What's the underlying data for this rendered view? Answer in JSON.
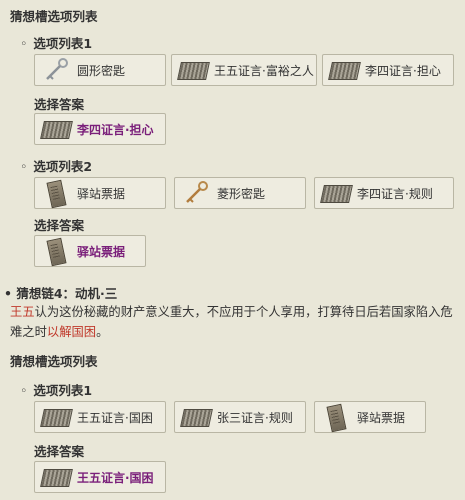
{
  "section1": {
    "title": "猜想槽选项列表",
    "list1": {
      "heading": "选项列表1",
      "options": [
        {
          "label": "圆形密匙",
          "icon": "key-icon"
        },
        {
          "label": "王五证言·富裕之人",
          "icon": "document-icon"
        },
        {
          "label": "李四证言·担心",
          "icon": "document-icon"
        }
      ],
      "answer_heading": "选择答案",
      "answer": {
        "label": "李四证言·担心",
        "icon": "document-icon"
      }
    },
    "list2": {
      "heading": "选项列表2",
      "options": [
        {
          "label": "驿站票据",
          "icon": "slip-icon"
        },
        {
          "label": "菱形密匙",
          "icon": "key-icon"
        },
        {
          "label": "李四证言·规则",
          "icon": "document-icon"
        }
      ],
      "answer_heading": "选择答案",
      "answer": {
        "label": "驿站票据",
        "icon": "slip-icon"
      }
    }
  },
  "chain4": {
    "title": "猜想链4：动机·三",
    "text_name": "王五",
    "text_body": "认为这份秘藏的财产意义重大，不应用于个人享用，打算待日后若国家陷入危难之时",
    "text_highlight": "以解国困",
    "text_end": "。"
  },
  "section2": {
    "title": "猜想槽选项列表",
    "list1": {
      "heading": "选项列表1",
      "options": [
        {
          "label": "王五证言·国困",
          "icon": "document-icon"
        },
        {
          "label": "张三证言·规则",
          "icon": "document-icon"
        },
        {
          "label": "驿站票据",
          "icon": "slip-icon"
        }
      ],
      "answer_heading": "选择答案",
      "answer": {
        "label": "王五证言·国困",
        "icon": "document-icon"
      }
    }
  },
  "colors": {
    "answer_text": "#7a1f7a",
    "highlight_red": "#c0392b",
    "background": "#e9e7d8"
  }
}
